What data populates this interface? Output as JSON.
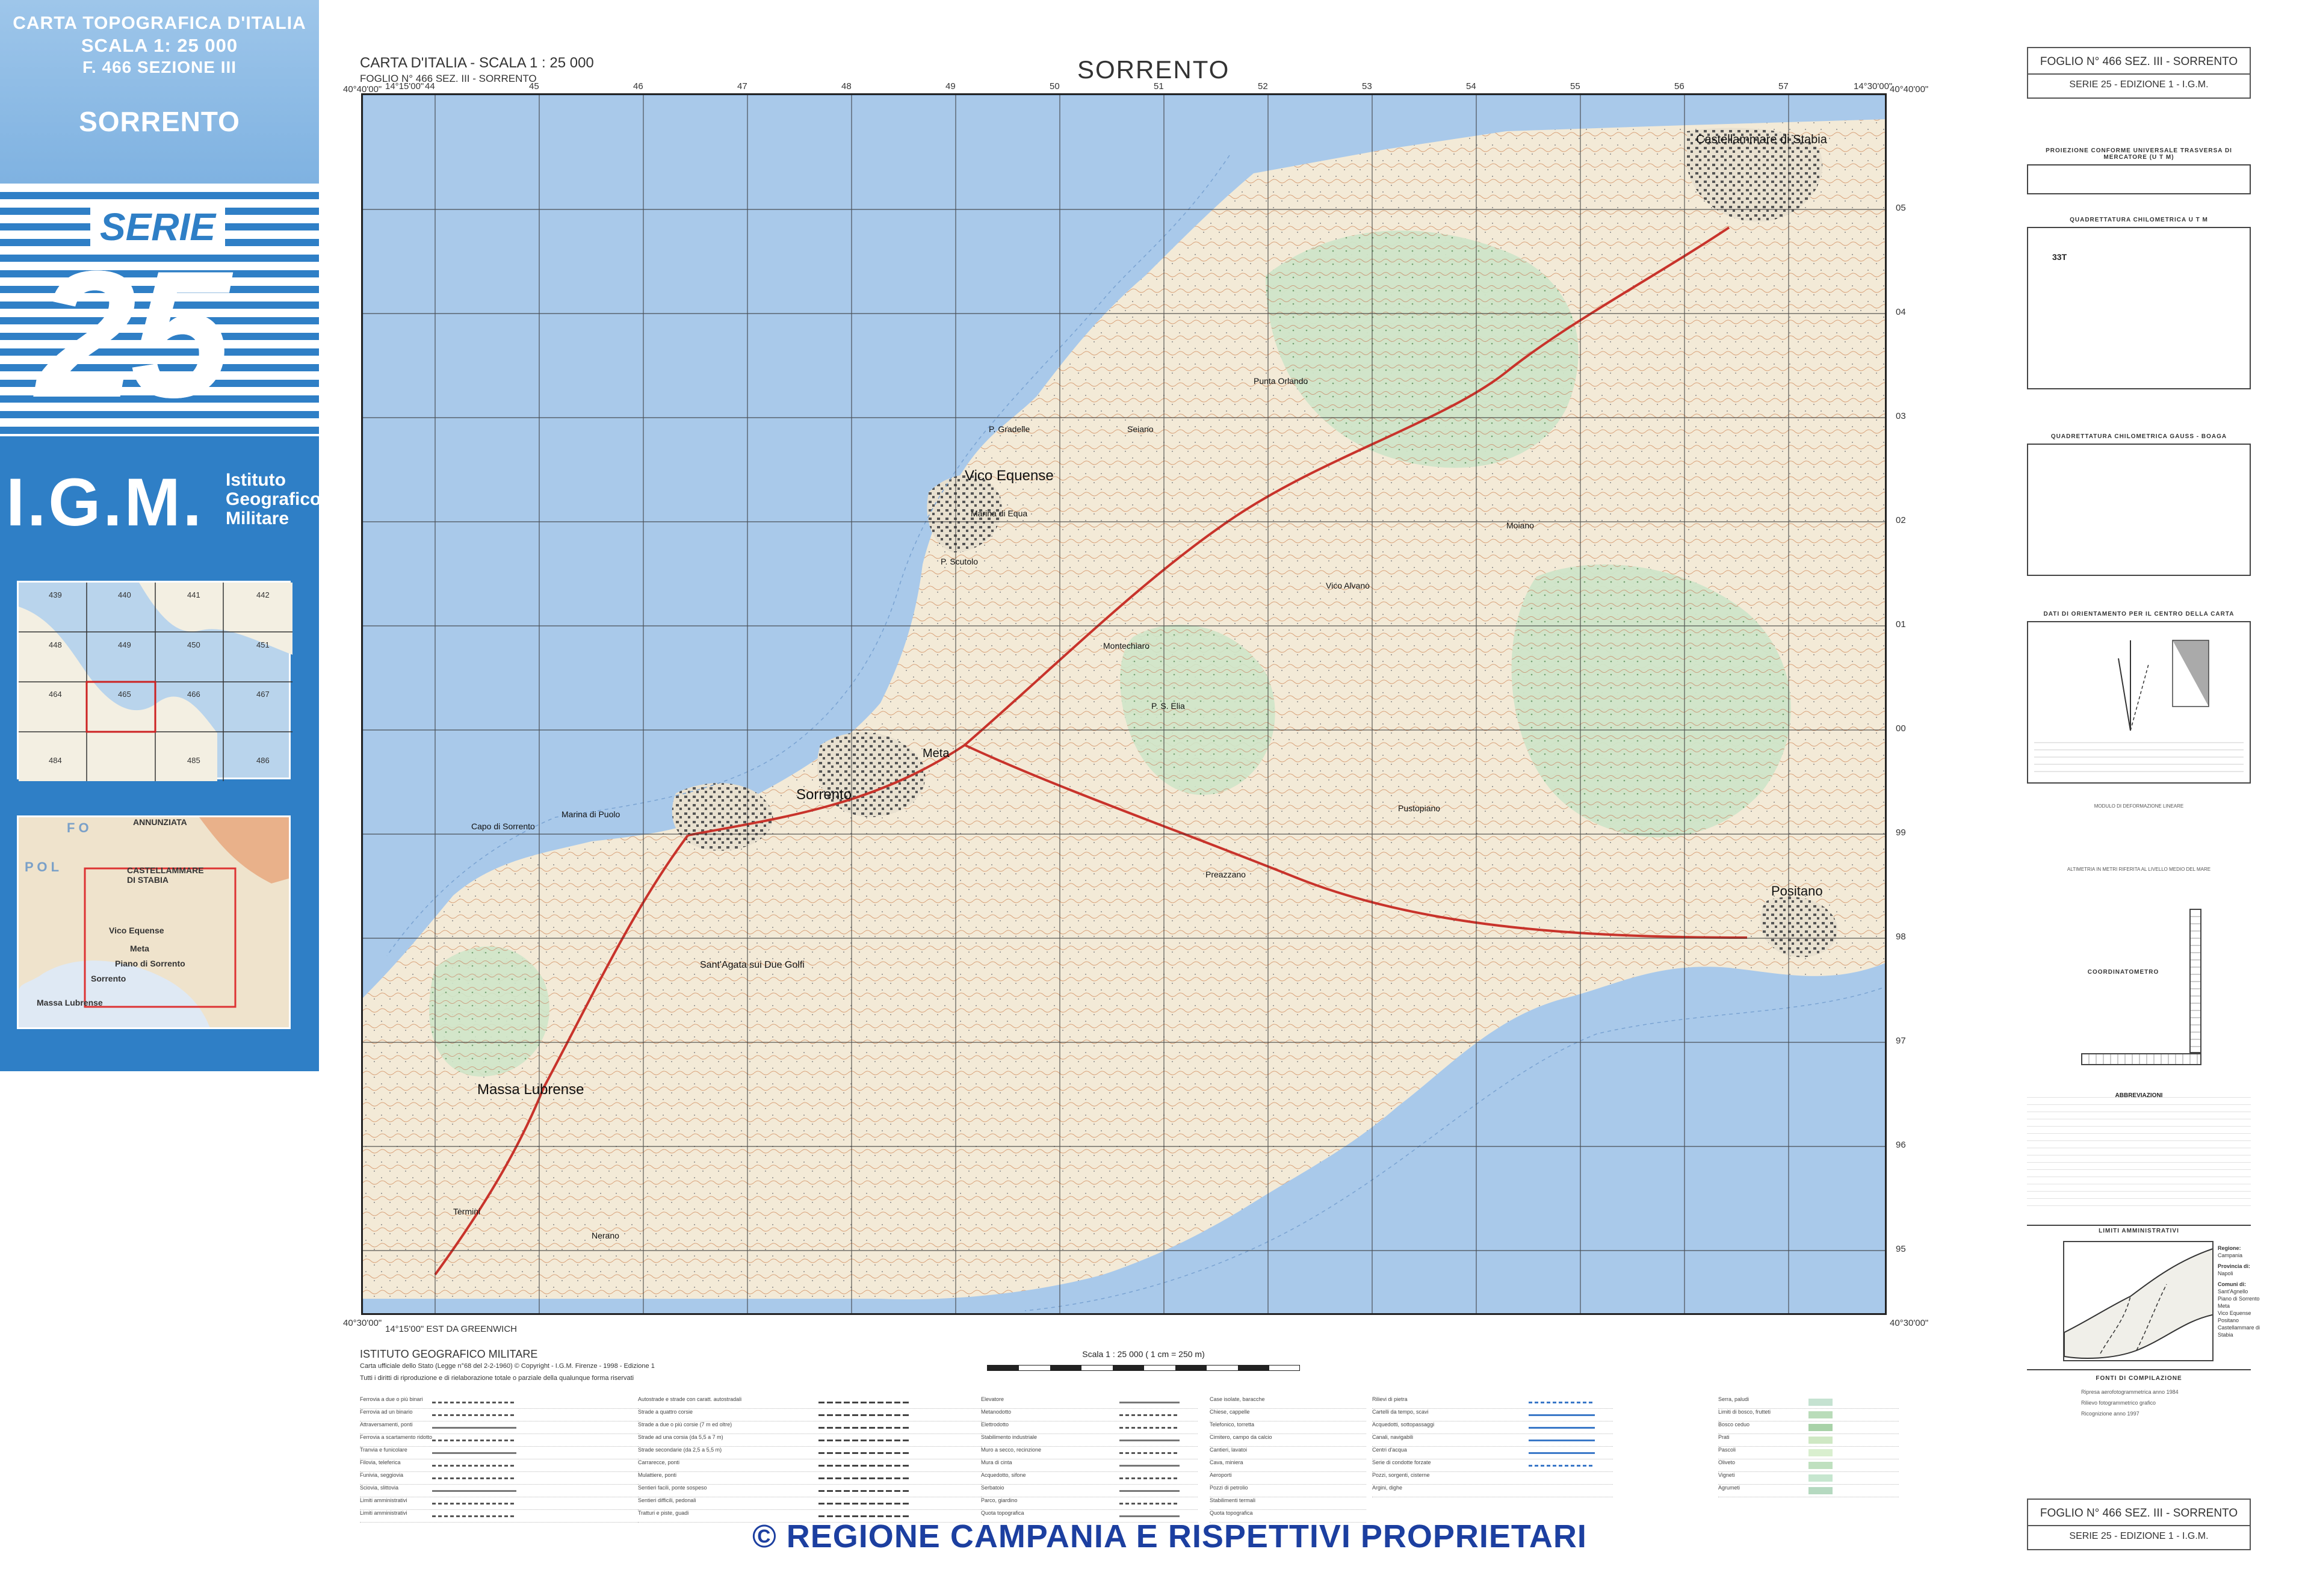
{
  "cover": {
    "line1": "CARTA TOPOGRAFICA D'ITALIA",
    "line2": "SCALA 1: 25 000",
    "line3": "F. 466 SEZIONE III",
    "name": "SORRENTO",
    "serie": "SERIE",
    "number": "25",
    "igm": "I.G.M.",
    "igm_full": [
      "Istituto",
      "Geografico",
      "Militare"
    ],
    "index_labels": [
      "439",
      "440",
      "441",
      "442",
      "448",
      "449",
      "450",
      "451",
      "464",
      "465",
      "466",
      "467",
      "484",
      "485",
      "486"
    ],
    "locator_labels": [
      "ANNUNZIATA",
      "CASTELLAMMARE DI STABIA",
      "Vico Equense",
      "Meta",
      "Piano di Sorrento",
      "Sorrento",
      "Massa Lubrense",
      "P O L",
      "F O"
    ]
  },
  "sheet": {
    "header_line1": "CARTA D'ITALIA - SCALA 1 : 25 000",
    "header_line2": "FOGLIO N° 466 SEZ. III - SORRENTO",
    "title": "SORRENTO",
    "corner_nw": "40°40'00\"",
    "corner_ne": "40°40'00\"",
    "corner_sw": "40°30'00\"",
    "corner_se": "40°30'00\"",
    "lon_w": "14°15'00\"",
    "lon_e": "14°30'00\"",
    "greenwich": "14°15'00\" EST DA GREENWICH",
    "easting_labels": [
      "44",
      "45",
      "46",
      "47",
      "48",
      "49",
      "50",
      "51",
      "52",
      "53",
      "54",
      "55",
      "56",
      "57"
    ],
    "northing_labels": [
      "05",
      "04",
      "03",
      "02",
      "01",
      "00",
      "99",
      "98",
      "97",
      "96",
      "95"
    ],
    "place_names": [
      "Castellammare di Stabia",
      "Vico Equense",
      "Marina di Equa",
      "P. Scutolo",
      "Meta",
      "Sorrento",
      "Marina di Puolo",
      "Capo di Sorrento",
      "Massa Lubrense",
      "Positano",
      "P. Gradelle",
      "Punta Orlando",
      "Seiano",
      "P. S. Elia",
      "Montechiaro",
      "Pustopiano",
      "Sant'Agata sui Due Golfi",
      "Termini",
      "Nerano",
      "Vico Alvano",
      "Moiano",
      "Preazzano"
    ]
  },
  "footer": {
    "igm_name": "ISTITUTO GEOGRAFICO MILITARE",
    "igm_note": "Carta ufficiale dello Stato (Legge n°68 del 2-2-1960) © Copyright - I.G.M. Firenze - 1998 - Edizione 1",
    "igm_note2": "Tutti i diritti di riproduzione e di rielaborazione totale o parziale della qualunque forma riservati",
    "scale_text": "Scala 1 : 25 000 ( 1 cm = 250 m)",
    "copyright": "© REGIONE CAMPANIA E RISPETTIVI PROPRIETARI"
  },
  "legend": {
    "col1": [
      "Ferrovia a due o più binari",
      "Ferrovia ad un binario",
      "Attraversamenti, ponti",
      "Ferrovia a scartamento ridotto",
      "Tranvia e funicolare",
      "Filovia, teleferica",
      "Funivia, seggiovia",
      "Sciovia, slittovia",
      "Limiti amministrativi",
      "Limiti amministrativi"
    ],
    "col2": [
      "Autostrade e strade con caratt. autostradali",
      "Strade a quattro corsie",
      "Strade a due o più corsie (7 m ed oltre)",
      "Strade ad una corsia (da 5,5 a 7 m)",
      "Strade secondarie (da 2,5 a 5,5 m)",
      "Carrarecce, ponti",
      "Mulattiere, ponti",
      "Sentieri facili, ponte sospeso",
      "Sentieri difficili, pedonali",
      "Tratturi e piste, guadi"
    ],
    "col3": [
      "Elevatore",
      "Metanodotto",
      "Elettrodotto",
      "Stabilimento industriale",
      "Muro a secco, recinzione",
      "Mura di cinta",
      "Acquedotto, sifone",
      "Serbatoio",
      "Parco, giardino",
      "Quota topografica"
    ],
    "col4": [
      "Case isolate, baracche",
      "Chiese, cappelle",
      "Telefonico, torretta",
      "Cimitero, campo da calcio",
      "Cantieri, lavatoi",
      "Cava, miniera",
      "Aeroporti",
      "Pozzi di petrolio",
      "Stabilimenti termali",
      "Quota topografica"
    ],
    "col5": [
      "Rilievi di pietra",
      "Cartelli da tempo, scavi",
      "Acquedotti, sottopassaggi",
      "Canali, navigabili",
      "Centri d'acqua",
      "Serie di condotte forzate",
      "Pozzi, sorgenti, cisterne",
      "Argini, dighe"
    ],
    "col6": [
      "Serra, paludi",
      "Limiti di bosco, frutteti",
      "Bosco ceduo",
      "Prati",
      "Pascoli",
      "Oliveto",
      "Vigneti",
      "Agrumeti"
    ]
  },
  "right": {
    "top_box_line1": "FOGLIO N° 466 SEZ. III - SORRENTO",
    "top_box_line2": "SERIE 25 - EDIZIONE 1 - I.G.M.",
    "proj_title": "PROIEZIONE CONFORME UNIVERSALE TRASVERSA DI MERCATORE (U T M)",
    "utm_title": "QUADRETTATURA CHILOMETRICA U T M",
    "utm_zone": "33T",
    "gauss_title": "QUADRETTATURA CHILOMETRICA GAUSS - BOAGA",
    "orient_title": "DATI DI ORIENTAMENTO PER IL CENTRO DELLA CARTA",
    "tone_title": "MODULO DI DEFORMAZIONE LINEARE",
    "altimetry": "ALTIMETRIA IN METRI RIFERITA AL LIVELLO MEDIO DEL MARE",
    "coordinatometro": "COORDINATOMETRO",
    "abbreviazioni": "ABBREVIAZIONI",
    "limiti": "LIMITI AMMINISTRATIVI",
    "regione_label": "Regione:",
    "regione": "Campania",
    "provincia_label": "Provincia di:",
    "provincia": "Napoli",
    "comuni_label": "Comuni di:",
    "comuni": [
      "Sant'Agnello",
      "Piano di Sorrento",
      "Meta",
      "Vico Equense",
      "Positano",
      "Castellammare di Stabia"
    ],
    "fonti": "FONTI DI COMPILAZIONE",
    "fonti_lines": [
      "Ripresa aerofotogrammetrica anno 1984",
      "Rilievo fotogrammetrico grafico",
      "Ricognizione anno 1997"
    ],
    "bottom_box_line1": "FOGLIO N° 466 SEZ. III - SORRENTO",
    "bottom_box_line2": "SERIE 25 - EDIZIONE 1 - I.G.M."
  }
}
